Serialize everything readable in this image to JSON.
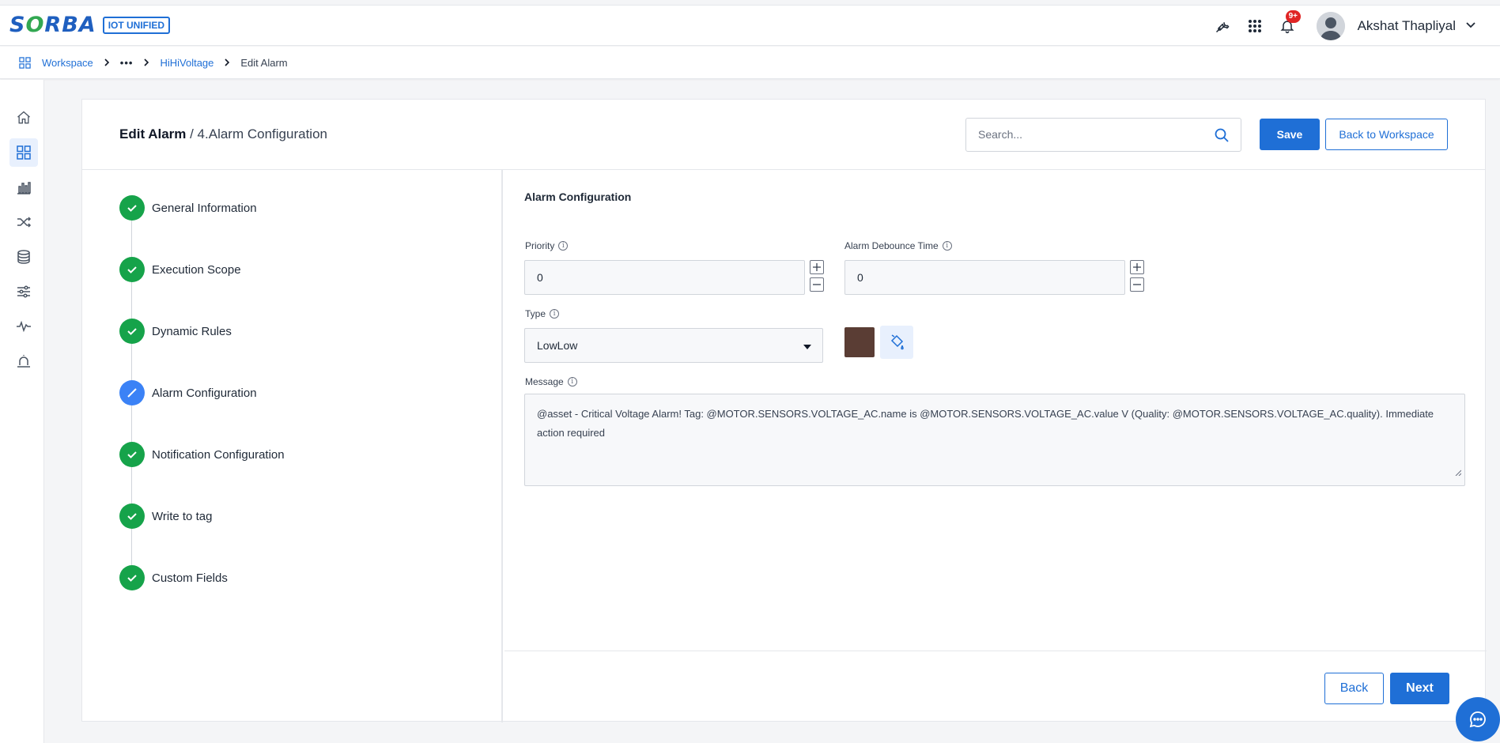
{
  "app": {
    "logo_text": "SORBA",
    "logo_badge": "IOT UNIFIED"
  },
  "topbar": {
    "icons": [
      "wrench-icon",
      "apps-grid-icon",
      "bell-icon"
    ],
    "notification_count": "9+",
    "user_name": "Akshat Thapliyal"
  },
  "breadcrumb": {
    "workspace": "Workspace",
    "ellipsis": "•••",
    "parent": "HiHiVoltage",
    "current": "Edit Alarm"
  },
  "sidebar": {
    "items": [
      "home-icon",
      "dashboard-icon",
      "analytics-icon",
      "flows-icon",
      "database-icon",
      "settings-sliders-icon",
      "activity-icon",
      "alarm-icon"
    ],
    "active": "dashboard-icon"
  },
  "header": {
    "title_bold": "Edit Alarm",
    "title_rest": " / 4.Alarm Configuration",
    "search_placeholder": "Search...",
    "save_label": "Save",
    "back_to_workspace_label": "Back to Workspace"
  },
  "steps": [
    {
      "label": "General Information",
      "state": "done"
    },
    {
      "label": "Execution Scope",
      "state": "done"
    },
    {
      "label": "Dynamic Rules",
      "state": "done"
    },
    {
      "label": "Alarm Configuration",
      "state": "current"
    },
    {
      "label": "Notification Configuration",
      "state": "done"
    },
    {
      "label": "Write to tag",
      "state": "done"
    },
    {
      "label": "Custom Fields",
      "state": "done"
    }
  ],
  "form": {
    "section_title": "Alarm Configuration",
    "priority_label": "Priority",
    "priority_value": "0",
    "debounce_label": "Alarm Debounce Time",
    "debounce_value": "0",
    "type_label": "Type",
    "type_value": "LowLow",
    "type_color": "#5a3d34",
    "message_label": "Message",
    "message_value": "@asset - Critical Voltage Alarm! Tag: @MOTOR.SENSORS.VOLTAGE_AC.name is @MOTOR.SENSORS.VOLTAGE_AC.value V (Quality: @MOTOR.SENSORS.VOLTAGE_AC.quality). Immediate action required",
    "back_label": "Back",
    "next_label": "Next"
  },
  "colors": {
    "primary": "#1f6fd6",
    "success": "#16a34a",
    "current_step": "#3b82f6",
    "danger": "#e02424"
  }
}
